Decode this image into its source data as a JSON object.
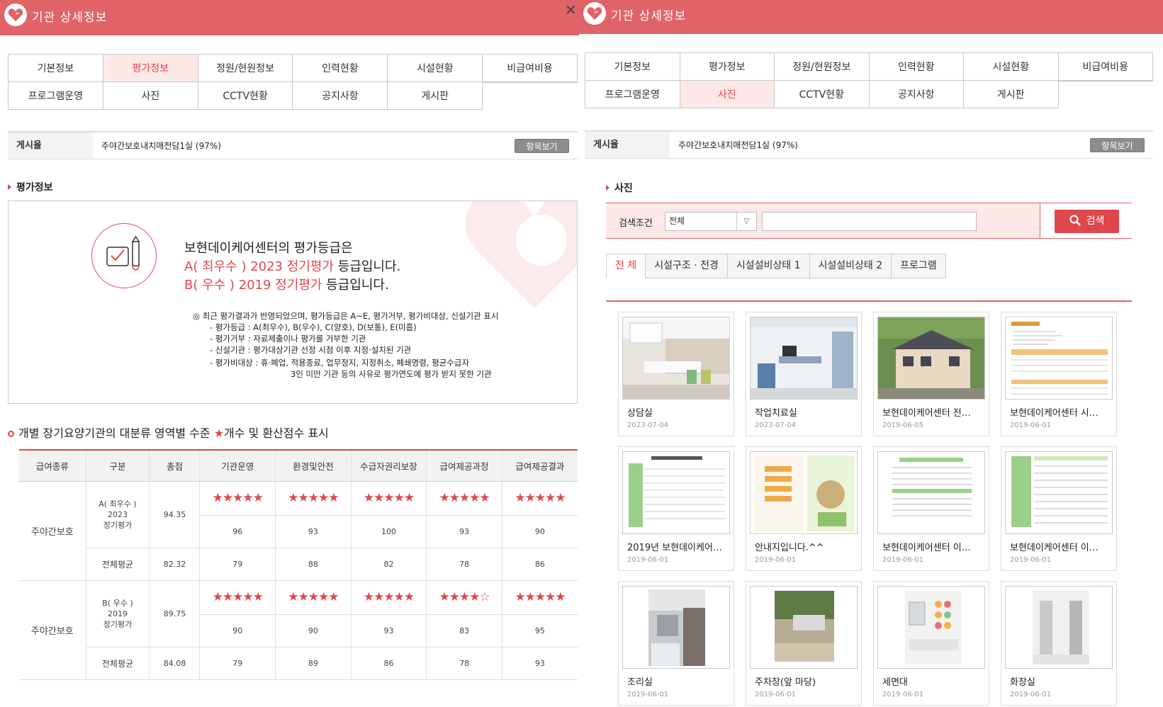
{
  "title": "기관 상세정보",
  "tabs_row1": [
    "기본정보",
    "평가정보",
    "정원/현원정보",
    "인력현황",
    "시설현황",
    "비급여비용"
  ],
  "tabs_row2": [
    "프로그램운영",
    "사진",
    "CCTV현황",
    "공지사항",
    "게시판"
  ],
  "info": {
    "label": "게시율",
    "value": "주야간보호내치매전담1실 (97%)",
    "button": "항목보기"
  },
  "eval": {
    "section": "평가정보",
    "line1": "보현데이케어센터의 평가등급은",
    "grade1": "A( 최우수 ) 2023 정기평가",
    "grade2": "B( 우수 ) 2019 정기평가",
    "suffix": " 등급입니다.",
    "notes": [
      "◎ 최근 평가결과가 반영되었으며, 평가등급은 A~E, 평가거부, 평가비대상, 신설기관 표시",
      "- 평가등급 : A(최우수), B(우수), C(양호), D(보통), E(미흡)",
      "- 평가거부 : 자료제출이나 평가를 거부한 기관",
      "- 신설기관 : 평가대상기관 선정 시점 이후 지정·설치된 기관",
      "- 평가비대상 : 휴·폐업, 적용종료, 업무정지, 지정취소, 폐쇄명령, 평균수급자",
      "3인 미만 기관 등의 사유로 평가연도에 평가 받지 못한 기관"
    ]
  },
  "table": {
    "title": "개별 장기요양기관의 대분류 영역별 수준",
    "title_star": "★",
    "title_rest": "개수 및 환산점수 표시",
    "headers": [
      "급여종류",
      "구분",
      "총점",
      "기관운영",
      "환경및안전",
      "수급자권리보장",
      "급여제공과정",
      "급여제공결과"
    ],
    "groups": [
      {
        "type": "주야간보호",
        "grade": "A( 최우수 )",
        "year": "2023",
        "kind": "정기평가",
        "total": "94.35",
        "stars": [
          5,
          5,
          5,
          5,
          5
        ],
        "scores": [
          "96",
          "93",
          "100",
          "93",
          "90"
        ],
        "avg_label": "전체평균",
        "avg_total": "82.32",
        "avg": [
          "79",
          "88",
          "82",
          "78",
          "86"
        ]
      },
      {
        "type": "주야간보호",
        "grade": "B( 우수 )",
        "year": "2019",
        "kind": "정기평가",
        "total": "89.75",
        "stars": [
          5,
          5,
          5,
          4,
          5
        ],
        "scores": [
          "90",
          "90",
          "93",
          "83",
          "95"
        ],
        "avg_label": "전체평균",
        "avg_total": "84.08",
        "avg": [
          "79",
          "89",
          "86",
          "78",
          "93"
        ]
      }
    ]
  },
  "photos": {
    "section": "사진",
    "search_label": "검색조건",
    "select_value": "전체",
    "search_button": "검색",
    "tabs": [
      "전 체",
      "시설구조 · 전경",
      "시설설비상태 1",
      "시설설비상태 2",
      "프로그램"
    ],
    "items": [
      {
        "caption": "상담실",
        "date": "2023-07-04",
        "kind": "room"
      },
      {
        "caption": "작업치료실",
        "date": "2023-07-04",
        "kind": "room2"
      },
      {
        "caption": "보현데이케어센터 전…",
        "date": "2019-06-05",
        "kind": "house"
      },
      {
        "caption": "보현데이케어센터 시…",
        "date": "2019-06-01",
        "kind": "doc"
      },
      {
        "caption": "2019년 보현데이케어…",
        "date": "2019-06-01",
        "kind": "doc2"
      },
      {
        "caption": "안내지입니다.^^",
        "date": "2019-06-01",
        "kind": "brochure"
      },
      {
        "caption": "보현데이케어센터 이…",
        "date": "2019-06-01",
        "kind": "doc3"
      },
      {
        "caption": "보현데이케어센터 이…",
        "date": "2019-06-01",
        "kind": "doc4"
      },
      {
        "caption": "조리실",
        "date": "2019-06-01",
        "kind": "kitchen"
      },
      {
        "caption": "주차장(앞 마당)",
        "date": "2019-06-01",
        "kind": "parking"
      },
      {
        "caption": "세면대",
        "date": "2019-06-01",
        "kind": "sink"
      },
      {
        "caption": "화장실",
        "date": "2019-06-01",
        "kind": "toilet"
      }
    ]
  }
}
